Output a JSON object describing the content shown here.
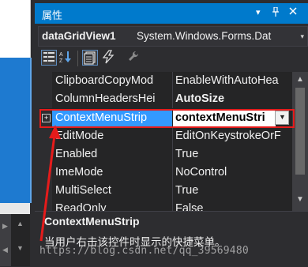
{
  "panel": {
    "title": "属性",
    "controls": [
      "▾",
      "📌",
      "✕"
    ]
  },
  "object_selector": {
    "name": "dataGridView1",
    "type": "System.Windows.Forms.Dat",
    "dropdown_glyph": "▾"
  },
  "toolbar": {
    "buttons": [
      "categorized-icon",
      "alphabetical-icon",
      "properties-icon",
      "events-icon",
      "property-pages-icon"
    ]
  },
  "properties": [
    {
      "name": "ClipboardCopyMod",
      "value": "EnableWithAutoHea"
    },
    {
      "name": "ColumnHeadersHei",
      "value": "AutoSize",
      "bold": true
    },
    {
      "name": "ContextMenuStrip",
      "value": "contextMenuStri",
      "selected": true
    },
    {
      "name": "EditMode",
      "value": "EditOnKeystrokeOrF"
    },
    {
      "name": "Enabled",
      "value": "True"
    },
    {
      "name": "ImeMode",
      "value": "NoControl"
    },
    {
      "name": "MultiSelect",
      "value": "True"
    },
    {
      "name": "ReadOnly",
      "value": "False"
    }
  ],
  "description": {
    "title": "ContextMenuStrip",
    "text": "当用户右击该控件时显示的快捷菜单。"
  },
  "watermark": "https://blog.csdn.net/qq_39569480",
  "colors": {
    "accent": "#007acc",
    "selection": "#3399ff",
    "highlight_box": "#e51b1b"
  }
}
